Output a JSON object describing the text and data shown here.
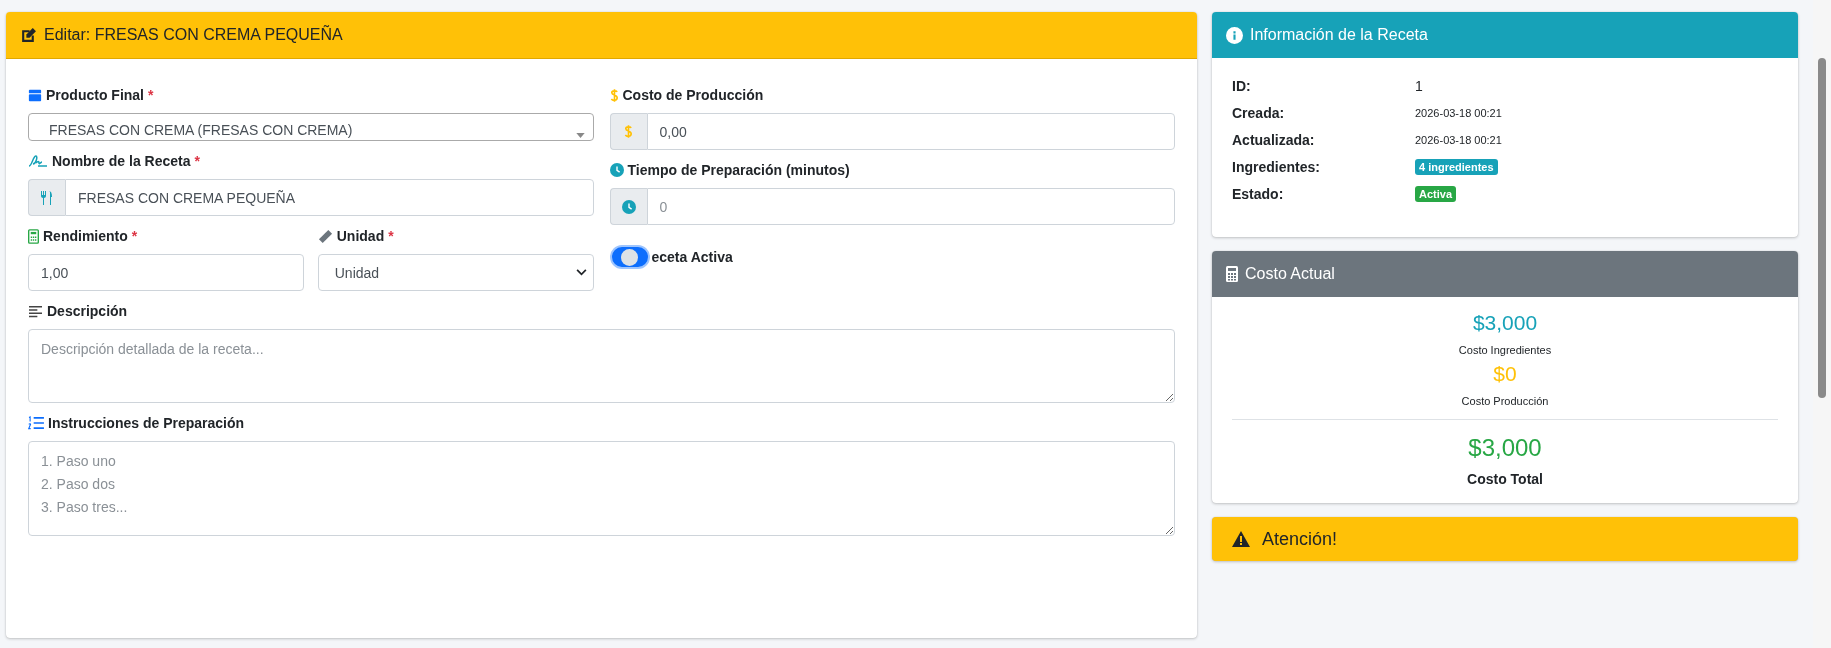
{
  "form": {
    "title": "Editar: FRESAS CON CREMA PEQUEÑA",
    "producto_final": {
      "label": "Producto Final",
      "mark": "*",
      "value": "FRESAS CON CREMA (FRESAS CON CREMA)"
    },
    "nombre": {
      "label": "Nombre de la Receta",
      "mark": "*",
      "value": "FRESAS CON CREMA PEQUEÑA"
    },
    "rendimiento": {
      "label": "Rendimiento",
      "mark": "*",
      "value": "1,00"
    },
    "unidad": {
      "label": "Unidad",
      "mark": "*",
      "value": "Unidad"
    },
    "costo_produccion": {
      "label": "Costo de Producción",
      "value": "0,00"
    },
    "tiempo": {
      "label": "Tiempo de Preparación (minutos)",
      "placeholder": "0"
    },
    "activa": {
      "label": "eceta Activa",
      "on": true
    },
    "descripcion": {
      "label": "Descripción",
      "placeholder": "Descripción detallada de la receta..."
    },
    "instrucciones": {
      "label": "Instrucciones de Preparación",
      "placeholder": "1. Paso uno\n2. Paso dos\n3. Paso tres..."
    }
  },
  "info": {
    "title": "Información de la Receta",
    "rows": [
      {
        "label": "ID:",
        "value": "1",
        "kind": "text"
      },
      {
        "label": "Creada:",
        "value": "2026-03-18 00:21",
        "kind": "small"
      },
      {
        "label": "Actualizada:",
        "value": "2026-03-18 00:21",
        "kind": "small"
      },
      {
        "label": "Ingredientes:",
        "value": "4 ingredientes",
        "kind": "badge",
        "color": "#17a2b8"
      },
      {
        "label": "Estado:",
        "value": "Activa",
        "kind": "badge",
        "color": "#28a745"
      }
    ]
  },
  "costo": {
    "title": "Costo Actual",
    "items": [
      {
        "amount": "$3,000",
        "caption": "Costo Ingredientes",
        "color": "#17a2b8",
        "kind": "part"
      },
      {
        "amount": "$0",
        "caption": "Costo Producción",
        "color": "#ffc107",
        "kind": "part"
      },
      {
        "amount": "$3,000",
        "caption": "Costo Total",
        "color": "#28a745",
        "kind": "total"
      }
    ]
  },
  "alert": {
    "title": "Atención!"
  }
}
